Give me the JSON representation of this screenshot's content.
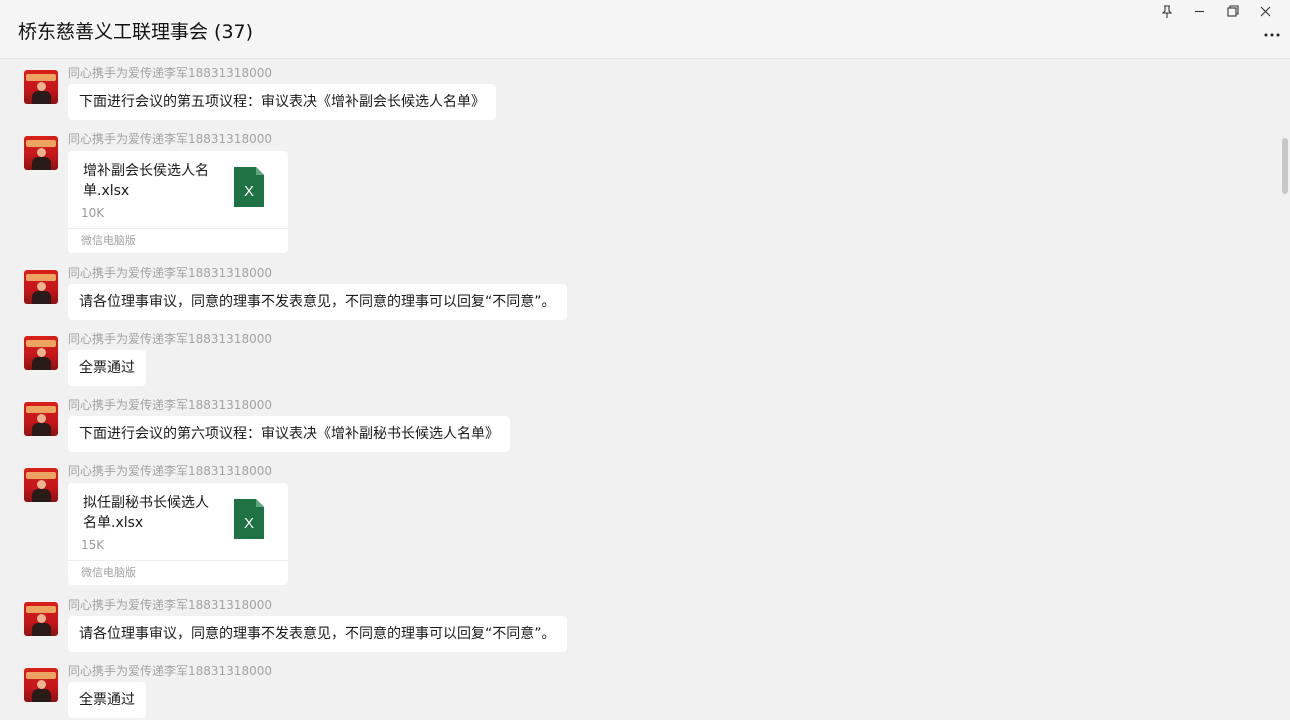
{
  "header": {
    "title": "桥东慈善义工联理事会 (37)",
    "pin_icon": "pin-icon",
    "minimize_icon": "minimize-icon",
    "restore_icon": "restore-icon",
    "close_icon": "close-icon",
    "more_icon": "more-icon"
  },
  "messages": [
    {
      "sender": "同心携手为爱传递李军18831318000",
      "text": "下面进行会议的第五项议程：审议表决《增补副会长候选人名单》"
    },
    {
      "sender": "同心携手为爱传递李军18831318000",
      "file": {
        "name": "增补副会长侯选人名单.xlsx",
        "size": "10K",
        "source": "微信电脑版",
        "icon": "excel-file-icon",
        "icon_letter": "X"
      }
    },
    {
      "sender": "同心携手为爱传递李军18831318000",
      "text": "请各位理事审议，同意的理事不发表意见，不同意的理事可以回复“不同意”。"
    },
    {
      "sender": "同心携手为爱传递李军18831318000",
      "text": "全票通过"
    },
    {
      "sender": "同心携手为爱传递李军18831318000",
      "text": "下面进行会议的第六项议程：审议表决《增补副秘书长候选人名单》"
    },
    {
      "sender": "同心携手为爱传递李军18831318000",
      "file": {
        "name": "拟任副秘书长候选人名单.xlsx",
        "size": "15K",
        "source": "微信电脑版",
        "icon": "excel-file-icon",
        "icon_letter": "X"
      }
    },
    {
      "sender": "同心携手为爱传递李军18831318000",
      "text": "请各位理事审议，同意的理事不发表意见，不同意的理事可以回复“不同意”。"
    },
    {
      "sender": "同心携手为爱传递李军18831318000",
      "text": "全票通过"
    }
  ],
  "colors": {
    "background": "#f1f1f1",
    "bubble": "#ffffff",
    "excel_green": "#1f7244",
    "sender_gray": "#a3a3a3"
  }
}
